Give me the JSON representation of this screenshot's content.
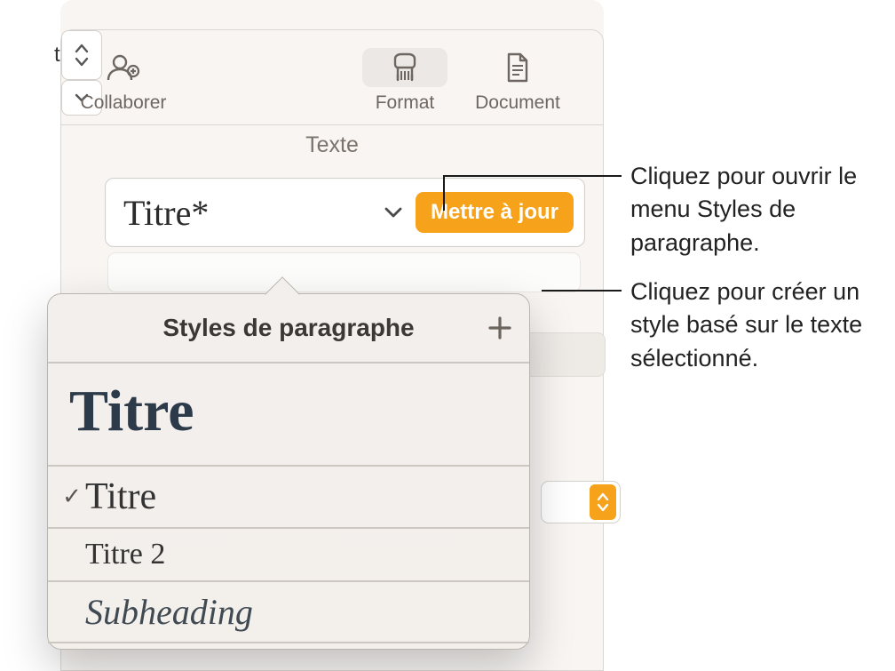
{
  "toolbar": {
    "collaborate": "Collaborer",
    "format": "Format",
    "document": "Document"
  },
  "text_section": {
    "title": "Texte"
  },
  "style_row": {
    "current": "Titre*",
    "update": "Mettre à jour"
  },
  "popover": {
    "header": "Styles de paragraphe",
    "preview": "Titre",
    "items": [
      {
        "label": "Titre",
        "checked": true
      },
      {
        "label": "Titre 2",
        "checked": false
      },
      {
        "label": "Subheading",
        "checked": false
      }
    ]
  },
  "hidden_controls": {
    "unit_suffix": "t"
  },
  "callouts": {
    "open_menu": "Cliquez pour ouvrir le menu Styles de paragraphe.",
    "create_style": "Cliquez pour créer un style basé sur le texte sélectionné."
  }
}
